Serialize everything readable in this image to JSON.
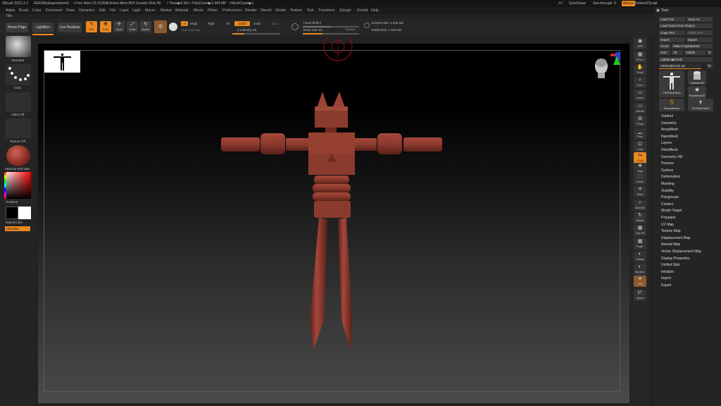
{
  "window": {
    "app_title": "ZBrush 2021.1.2",
    "doc_title": "FER3N(disapontment)",
    "free_mem": "• Free Mem 21.519GB",
    "active_mem": "• Active Mem 857",
    "scratch_disk": "• Scratch Disk 49",
    "timer": "• Timer▶0.001",
    "polycount": "• PolyCount▶1.943 MP",
    "meshcount": "• MeshCount▶1",
    "ac": "AC",
    "quicksave": "QuickSave",
    "seethrough": "See-through",
    "seethrough_val": "0",
    "menus_btn": "Menus",
    "script": "DefaultZScript"
  },
  "menubar": [
    "Alpha",
    "Brush",
    "Color",
    "Document",
    "Draw",
    "Dynamics",
    "Edit",
    "File",
    "Layer",
    "Light",
    "Macro",
    "Marker",
    "Material",
    "Movie",
    "Picker",
    "Preferences",
    "Render",
    "Stencil",
    "Stroke",
    "Texture",
    "Tool",
    "Transform",
    "Zplugin",
    "Zscript",
    "Help"
  ],
  "subtitle": "Title",
  "topshelf": {
    "home_page": "Home Page",
    "lightbox": "LightBox",
    "live_boolean": "Live Boolean",
    "edit": "Edit",
    "draw": "Draw",
    "move": "Move",
    "scale": "Scale",
    "rotate": "Rotate",
    "a_btn": "A",
    "mrgb": "Mrgb",
    "rgb": "Rgb",
    "m": "M",
    "zadd": "Zadd",
    "zsub": "Zsub",
    "zcut": "Zcut",
    "rgb_intensity": "Rgb Intensity",
    "z_intensity": "Z Intensity 25",
    "focal_shift": "Focal Shift 0",
    "draw_size": "Draw Size 64",
    "dynamic": "Dynamic",
    "active_points": "ActivePoints: 1.946 Mil",
    "total_points": "TotalPoints: 1.946 Mil"
  },
  "leftpanel": {
    "standard": "Standard",
    "dots": "Dots",
    "alpha_off": "Alpha Off",
    "texture_off": "Texture Off",
    "matcap": "MatCap Red Wax",
    "gradient": "Gradient",
    "switch_color": "SwitchColor",
    "alternate": "Alternate"
  },
  "rightstrip": [
    {
      "name": "bpr",
      "label": "BPR"
    },
    {
      "name": "spix",
      "label": "SPix 3"
    },
    {
      "name": "scroll",
      "label": "Scroll"
    },
    {
      "name": "zoom",
      "label": "Zoom"
    },
    {
      "name": "actual",
      "label": "Actual"
    },
    {
      "name": "aahalf",
      "label": "AAHalf"
    },
    {
      "name": "persp",
      "label": "Persp"
    },
    {
      "name": "floor",
      "label": "Floor"
    },
    {
      "name": "local",
      "label": "Local"
    },
    {
      "name": "lsym",
      "label": "L.Sym"
    },
    {
      "name": "xyz",
      "label": "Gxyz"
    },
    {
      "name": "frame",
      "label": "Frame"
    },
    {
      "name": "move",
      "label": "Move"
    },
    {
      "name": "zoom3d",
      "label": "Zoom3D"
    },
    {
      "name": "rotate",
      "label": "Rotate"
    },
    {
      "name": "linefill",
      "label": "Line Fill"
    },
    {
      "name": "polyf",
      "label": "PolyF"
    },
    {
      "name": "transp",
      "label": "Transp"
    },
    {
      "name": "dynamic",
      "label": "Dynamic"
    },
    {
      "name": "solo",
      "label": "Solo"
    },
    {
      "name": "xpose",
      "label": "Xpose"
    }
  ],
  "toolpanel": {
    "header": "Tool",
    "load_tool": "Load Tool",
    "save_as": "Save As",
    "load_from_project": "Load Tools From Project",
    "copy_tool": "Copy Tool",
    "paste_tool": "Paste Tool",
    "import": "Import",
    "export": "Export",
    "clone": "Clone",
    "make_polymesh": "Make PolyMesh3D",
    "goz": "GoZ",
    "all": "All",
    "visible": "Visible",
    "r": "R",
    "lightbox_tools": "Lightbox▶Tools",
    "current_tool": "FER3N(DIAD)",
    "current_tool_val": "48",
    "r2": "R",
    "thumbs": [
      {
        "name": "fer3n-diad",
        "label": "FER3N(DIAD)"
      },
      {
        "name": "cylinder3d",
        "label": "Cylinder3D"
      },
      {
        "name": "polymesh3d",
        "label": "PolyMesh3D"
      },
      {
        "name": "simplebrush",
        "label": "SimpleBrush"
      },
      {
        "name": "fer3n-diad2",
        "label": "FER3N(DIAD)"
      }
    ],
    "items": [
      "Subtool",
      "Geometry",
      "ArrayMesh",
      "NanoMesh",
      "Layers",
      "FiberMesh",
      "Geometry HD",
      "Preview",
      "Surface",
      "Deformation",
      "Masking",
      "Visibility",
      "Polygroups",
      "Contact",
      "Morph Target",
      "Polypaint",
      "UV Map",
      "Texture Map",
      "Displacement Map",
      "Normal Map",
      "Vector Displacement Map",
      "Display Properties",
      "Unified Skin",
      "Initialize",
      "Import",
      "Export"
    ]
  },
  "colors": {
    "accent": "#e8881e",
    "model": "#8b3a2e",
    "bg": "#222222"
  }
}
